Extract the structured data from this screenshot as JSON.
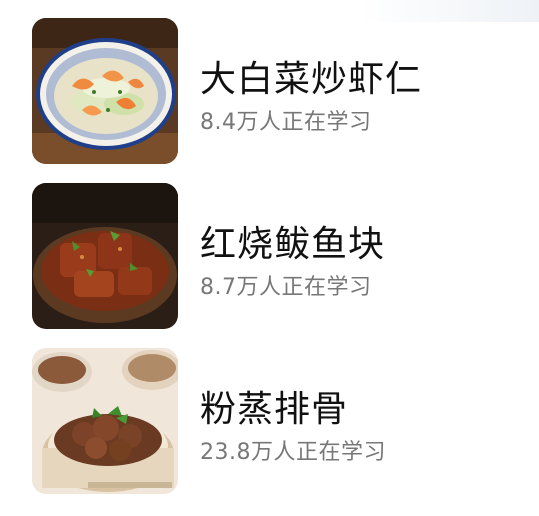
{
  "recipes": [
    {
      "title": "大白菜炒虾仁",
      "learners": "8.4万人正在学习"
    },
    {
      "title": "红烧鲅鱼块",
      "learners": "8.7万人正在学习"
    },
    {
      "title": "粉蒸排骨",
      "learners": "23.8万人正在学习"
    }
  ]
}
